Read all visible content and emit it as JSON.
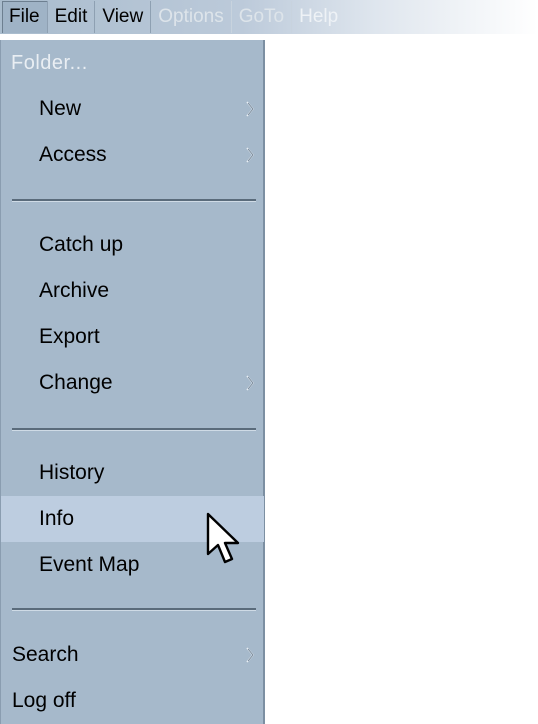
{
  "menubar": {
    "items": [
      "File",
      "Edit",
      "View",
      "Options",
      "GoTo",
      "Help"
    ]
  },
  "dropdown": {
    "header": "Folder...",
    "items": {
      "new": "New",
      "access": "Access",
      "catch_up": "Catch up",
      "archive": "Archive",
      "export": "Export",
      "change": "Change",
      "history": "History",
      "info": "Info",
      "event_map": "Event Map",
      "search": "Search",
      "log_off": "Log off"
    }
  },
  "icons": {
    "submenu": "chevron-right-icon",
    "cursor": "mouse-pointer-icon"
  },
  "colors": {
    "menu_background": "#a6b9cb",
    "highlight": "#bdcde0"
  }
}
